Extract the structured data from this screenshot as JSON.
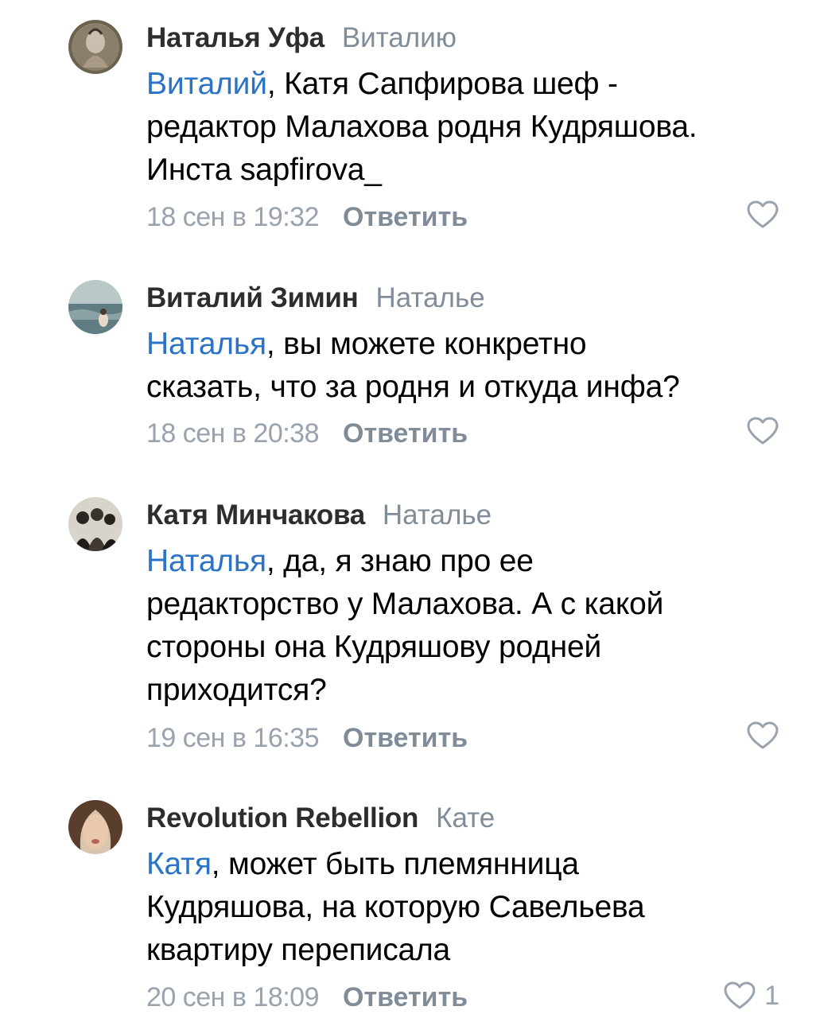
{
  "reply_label": "Ответить",
  "colors": {
    "mention": "#2a73c6",
    "secondary": "#818c99",
    "author": "#2c2d2e"
  },
  "comments": [
    {
      "author": "Наталья Уфа",
      "reply_to": "Виталию",
      "mention": "Виталий",
      "text_lines": [
        ", Катя Сапфирова шеф -",
        "редактор Малахова родня Кудряшова.",
        "Инста sapfirova_"
      ],
      "date": "18 сен в 19:32",
      "likes": ""
    },
    {
      "author": "Виталий Зимин",
      "reply_to": "Наталье",
      "mention": "Наталья",
      "text_lines": [
        ", вы можете конкретно",
        "сказать, что за родня и откуда инфа?"
      ],
      "date": "18 сен в 20:38",
      "likes": ""
    },
    {
      "author": "Катя Минчакова",
      "reply_to": "Наталье",
      "mention": "Наталья",
      "text_lines": [
        ", да, я знаю про ее",
        "редакторство у Малахова. А с какой",
        "стороны она Кудряшову родней",
        "приходится?"
      ],
      "date": "19 сен в 16:35",
      "likes": ""
    },
    {
      "author": "Revolution Rebellion",
      "reply_to": "Кате",
      "mention": "Катя",
      "text_lines": [
        ", может быть племянница",
        "Кудряшова, на которую Савельева",
        "квартиру переписала"
      ],
      "date": "20 сен в 18:09",
      "likes": "1"
    }
  ]
}
